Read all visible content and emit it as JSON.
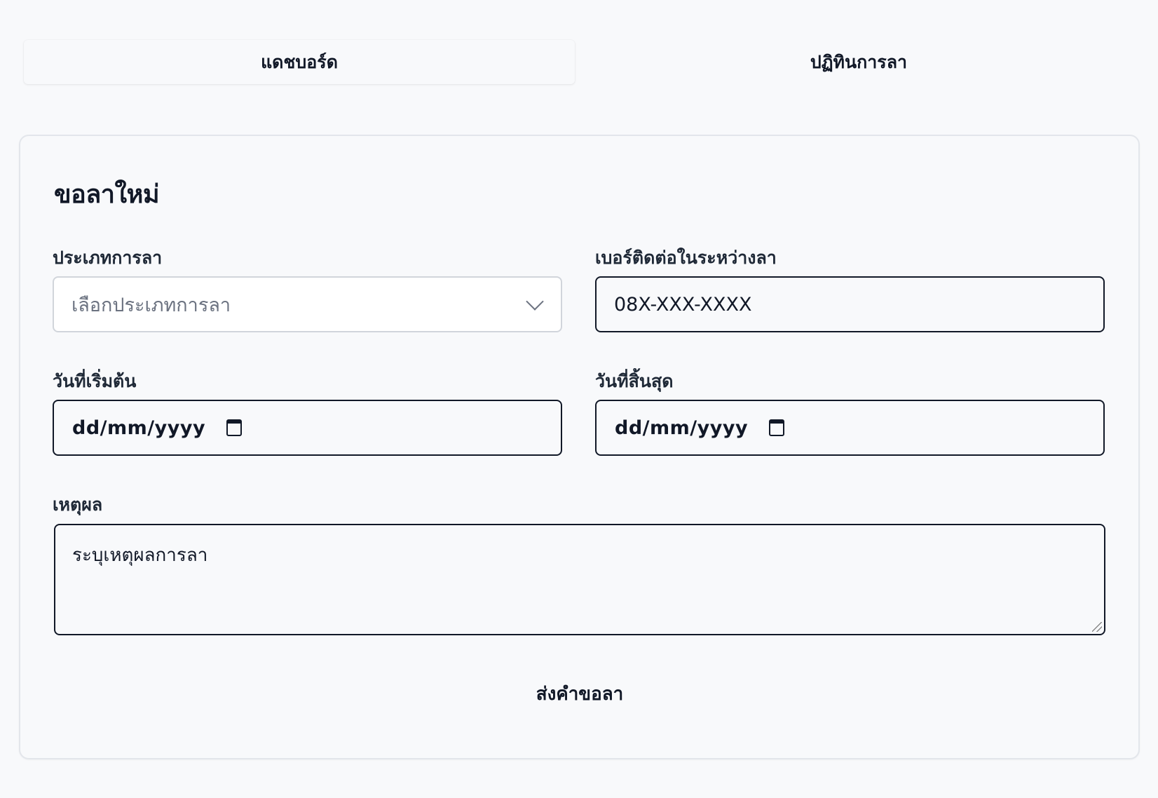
{
  "tabs": {
    "dashboard": "แดชบอร์ด",
    "calendar": "ปฏิทินการลา"
  },
  "form": {
    "title": "ขอลาใหม่",
    "leave_type": {
      "label": "ประเภทการลา",
      "placeholder": "เลือกประเภทการลา"
    },
    "contact": {
      "label": "เบอร์ติดต่อในระหว่างลา",
      "placeholder": "08X-XXX-XXXX"
    },
    "start_date": {
      "label": "วันที่เริ่มต้น",
      "placeholder": "dd/mm/yyyy"
    },
    "end_date": {
      "label": "วันที่สิ้นสุด",
      "placeholder": "dd/mm/yyyy"
    },
    "reason": {
      "label": "เหตุผล",
      "placeholder": "ระบุเหตุผลการลา"
    },
    "submit_label": "ส่งคำขอลา"
  },
  "icons": {
    "select": "chevron-down-icon",
    "date": "calendar-icon"
  }
}
